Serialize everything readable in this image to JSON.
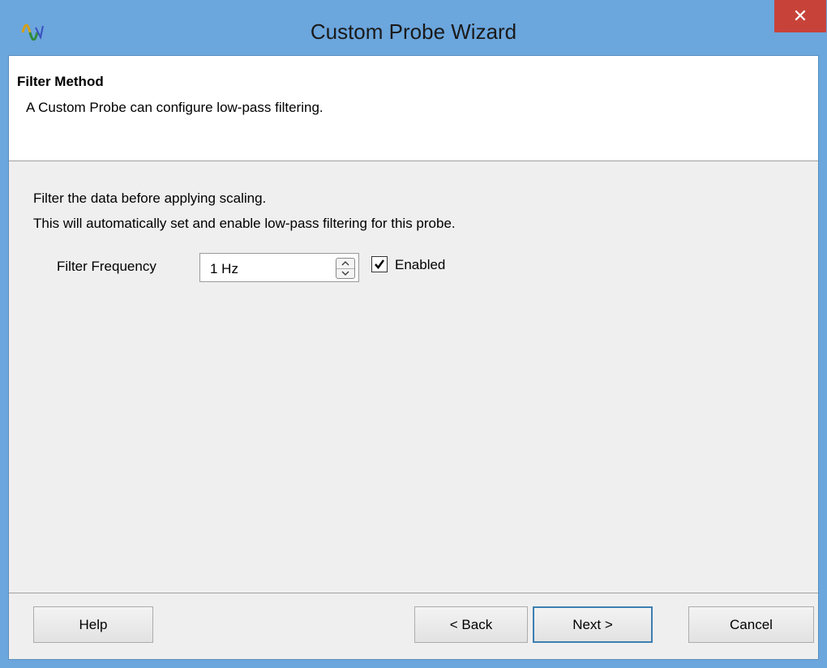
{
  "window": {
    "title": "Custom Probe Wizard",
    "close_glyph": "✕",
    "icon": "waveform-app-icon"
  },
  "header": {
    "title": "Filter Method",
    "description": "A Custom Probe can configure low-pass filtering."
  },
  "body": {
    "line1": "Filter the data before applying scaling.",
    "line2": "This will automatically set and enable low-pass filtering for this probe."
  },
  "filter": {
    "label": "Filter Frequency",
    "value": "1 Hz",
    "enabled_label": "Enabled",
    "enabled": true
  },
  "buttons": {
    "help": "Help",
    "back": "< Back",
    "next": "Next >",
    "cancel": "Cancel"
  },
  "colors": {
    "titlebar": "#6ba6dd",
    "close": "#c7433a",
    "panel": "#efefef",
    "header": "#ffffff"
  }
}
